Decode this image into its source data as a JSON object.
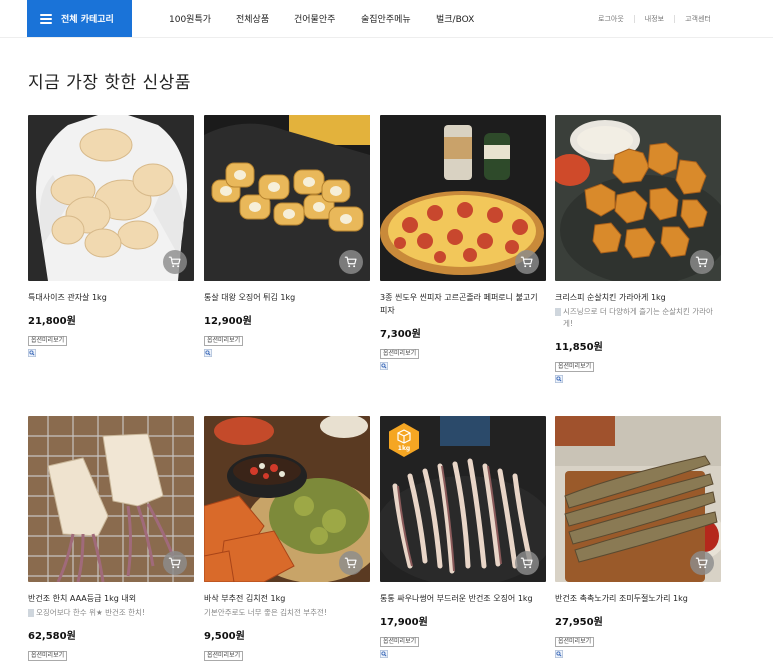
{
  "header": {
    "category_label": "전체 카테고리",
    "nav": [
      "100원특가",
      "전체상품",
      "건어물안주",
      "술집안주메뉴",
      "벌크/BOX"
    ],
    "util": [
      "로그아웃",
      "내정보",
      "고객센터"
    ]
  },
  "section": {
    "title": "지금 가장 핫한 신상품"
  },
  "products": [
    {
      "name": "특대사이즈 관자살 1kg",
      "desc": "",
      "price": "21,800원",
      "option_label": "옵션미리보기",
      "badge": ""
    },
    {
      "name": "통살 대왕 오징어 튀김 1kg",
      "desc": "",
      "price": "12,900원",
      "option_label": "옵션미리보기",
      "badge": ""
    },
    {
      "name": "3종 씬도우 씬피자 고르곤졸라 페퍼로니 불고기 피자",
      "desc": "",
      "price": "7,300원",
      "option_label": "옵션미리보기",
      "badge": ""
    },
    {
      "name": "크리스피 순살치킨 가라아게 1kg",
      "desc": "시즈닝으로 더 다양하게 즐기는 순살치킨 가라아게!",
      "price": "11,850원",
      "option_label": "옵션미리보기",
      "badge": ""
    },
    {
      "name": "반건조 한치 AAA등급 1kg 내외",
      "desc": "오징어보다 한수 위★ 반건조 한치!",
      "price": "62,580원",
      "option_label": "옵션미리보기",
      "badge": ""
    },
    {
      "name": "바삭 부추전 김치전 1kg",
      "desc": "기본안주로도 너무 좋은 김치전 부추전!",
      "price": "9,500원",
      "option_label": "옵션미리보기",
      "badge": ""
    },
    {
      "name": "통통 싸우나썽어 부드러운 반건조 오징어 1kg",
      "desc": "",
      "price": "17,900원",
      "option_label": "옵션미리보기",
      "badge": "1kg"
    },
    {
      "name": "반건조 촉촉노가리 조미두절노가리 1kg",
      "desc": "",
      "price": "27,950원",
      "option_label": "옵션미리보기",
      "badge": ""
    }
  ],
  "colors": {
    "accent": "#1a73d8",
    "badge": "#f5a623",
    "cart_button": "#8c8c8c"
  }
}
